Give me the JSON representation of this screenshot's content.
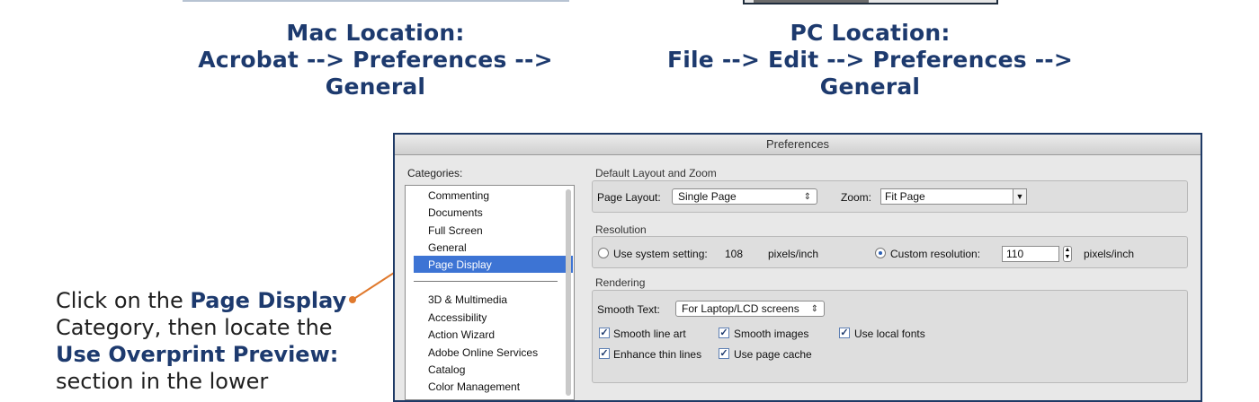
{
  "header": {
    "mac_title": "Mac Location:",
    "mac_path": "Acrobat --> Preferences --> General",
    "pc_title": "PC Location:",
    "pc_path": "File --> Edit --> Preferences --> General"
  },
  "instruction": {
    "part1": "Click on the ",
    "bold1": "Page Display",
    "part2": " Category, then locate the ",
    "bold2": "Use Overprint Preview:",
    "part3": " section in the lower"
  },
  "window": {
    "title": "Preferences",
    "categories_label": "Categories:",
    "categories": [
      "Commenting",
      "Documents",
      "Full Screen",
      "General",
      "Page Display"
    ],
    "selected_category": "Page Display",
    "categories_more": [
      "3D & Multimedia",
      "Accessibility",
      "Action Wizard",
      "Adobe Online Services",
      "Catalog",
      "Color Management"
    ],
    "default_layout": {
      "title": "Default Layout and Zoom",
      "page_layout_label": "Page Layout:",
      "page_layout_value": "Single Page",
      "zoom_label": "Zoom:",
      "zoom_value": "Fit Page"
    },
    "resolution": {
      "title": "Resolution",
      "system_label": "Use system setting:",
      "system_value": "108",
      "system_unit": "pixels/inch",
      "custom_label": "Custom resolution:",
      "custom_value": "110",
      "custom_unit": "pixels/inch"
    },
    "rendering": {
      "title": "Rendering",
      "smooth_text_label": "Smooth Text:",
      "smooth_text_value": "For Laptop/LCD screens",
      "smooth_line_art": "Smooth line art",
      "smooth_images": "Smooth images",
      "use_local_fonts": "Use local fonts",
      "enhance_thin_lines": "Enhance thin lines",
      "use_page_cache": "Use page cache"
    }
  },
  "colors": {
    "accent": "#1d3a6e",
    "selection": "#3d74d4",
    "highlight": "#e07a2e"
  }
}
